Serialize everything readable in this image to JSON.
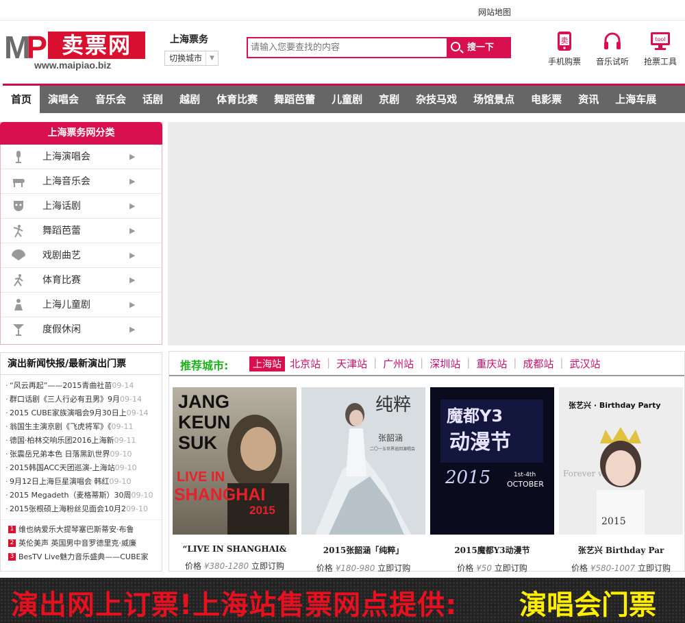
{
  "topbar": {
    "sitemap": "网站地图"
  },
  "header": {
    "logo": {
      "m": "M",
      "p": "P",
      "cn": "卖票网",
      "url": "www.maipiao.biz"
    },
    "city_title": "上海票务",
    "city_switch": "切换城市",
    "search": {
      "placeholder": "请输入您要查找的内容",
      "button": "搜一下"
    },
    "tools": [
      {
        "label": "手机购票",
        "icon": "mobile-ticket-icon"
      },
      {
        "label": "音乐试听",
        "icon": "headphones-icon"
      },
      {
        "label": "抢票工具",
        "icon": "tool-monitor-icon",
        "badge": "tool"
      }
    ]
  },
  "nav": [
    "首页",
    "演唱会",
    "音乐会",
    "话剧",
    "越剧",
    "体育比赛",
    "舞蹈芭蕾",
    "儿童剧",
    "京剧",
    "杂技马戏",
    "场馆景点",
    "电影票",
    "资讯",
    "上海车展"
  ],
  "categories": {
    "title": "上海票务网分类",
    "items": [
      {
        "label": "上海演唱会",
        "icon": "microphone-icon"
      },
      {
        "label": "上海音乐会",
        "icon": "piano-icon"
      },
      {
        "label": "上海话剧",
        "icon": "mask-icon"
      },
      {
        "label": "舞蹈芭蕾",
        "icon": "dancer-icon"
      },
      {
        "label": "戏剧曲艺",
        "icon": "fan-icon"
      },
      {
        "label": "体育比赛",
        "icon": "runner-icon"
      },
      {
        "label": "上海儿童剧",
        "icon": "child-icon"
      },
      {
        "label": "度假休闲",
        "icon": "cocktail-icon"
      }
    ]
  },
  "news": {
    "title": "演出新闻快报/最新演出门票",
    "items": [
      {
        "text": "“风云再起”——2015青曲社苗",
        "date": "09-14"
      },
      {
        "text": "群口话剧《三人行必有丑男》9月",
        "date": "09-14"
      },
      {
        "text": "2015 CUBE家族演唱会9月30日上",
        "date": "09-14"
      },
      {
        "text": "翁国生主演京剧《飞虎将军》《",
        "date": "09-11"
      },
      {
        "text": "德国·柏林交响乐团2016上海新",
        "date": "09-11"
      },
      {
        "text": "张震岳兄弟本色 日落黑趴世界",
        "date": "09-10"
      },
      {
        "text": "2015韩国ACC天团巡演-上海站",
        "date": "09-10"
      },
      {
        "text": "9月12日上海巨星演唱会 韩红",
        "date": "09-10"
      },
      {
        "text": "2015 Megadeth（麦格蒂斯）30周",
        "date": "09-10"
      },
      {
        "text": "2015张根硕上海粉丝见面会10月2",
        "date": "09-10"
      }
    ],
    "hot": [
      {
        "num": "1",
        "text": "维也纳爱乐大提琴塞巴斯蒂安·布鲁"
      },
      {
        "num": "2",
        "text": "英伦美声 英国男中音罗德里克·威廉"
      },
      {
        "num": "3",
        "text": "BesTV Live魅力音乐盛典——CUBE家"
      }
    ]
  },
  "recommend": {
    "title": "推荐城市:",
    "cities": [
      "上海站",
      "北京站",
      "天津站",
      "广州站",
      "深圳站",
      "重庆站",
      "成都站",
      "武汉站"
    ],
    "active_city": "上海站",
    "cards": [
      {
        "name": "“LIVE IN SHANGHAI&",
        "price_label": "价格",
        "price": "¥380-1280",
        "order": "立即订购",
        "poster": {
          "line1": "JANG",
          "line2": "KEUN",
          "line3": "SUK",
          "live": "LIVE IN",
          "city": "SHANGHAI",
          "year": "2015"
        }
      },
      {
        "name": "2015张韶涵「纯粹」",
        "price_label": "价格",
        "price": "¥180-980",
        "order": "立即订购",
        "poster": {
          "title": "纯粹",
          "sub": "张韶涵",
          "tour": "二〇一五世界巡回演唱会"
        }
      },
      {
        "name": "2015魔都Y3动漫节",
        "price_label": "价格",
        "price": "¥50",
        "order": "立即订购",
        "poster": {
          "title1": "魔都Y3",
          "title2": "动漫节",
          "year": "2015",
          "month": "OCTOBER",
          "days": "1st-4th"
        }
      },
      {
        "name": "张艺兴 Birthday Par",
        "price_label": "价格",
        "price": "¥580-1007",
        "order": "立即订购",
        "poster": {
          "title": "张艺兴 · Birthday Party",
          "tagline": "Forever with me",
          "year": "2015"
        }
      }
    ]
  },
  "footer_banner": {
    "text_red": "演出网上订票!上海站售票网点提供:",
    "text_yellow": "演唱会门票"
  },
  "colors": {
    "brand": "#d9104f",
    "nav_bg": "#666666",
    "city_link": "#c80f6e",
    "rec_title": "#1bb31b"
  }
}
